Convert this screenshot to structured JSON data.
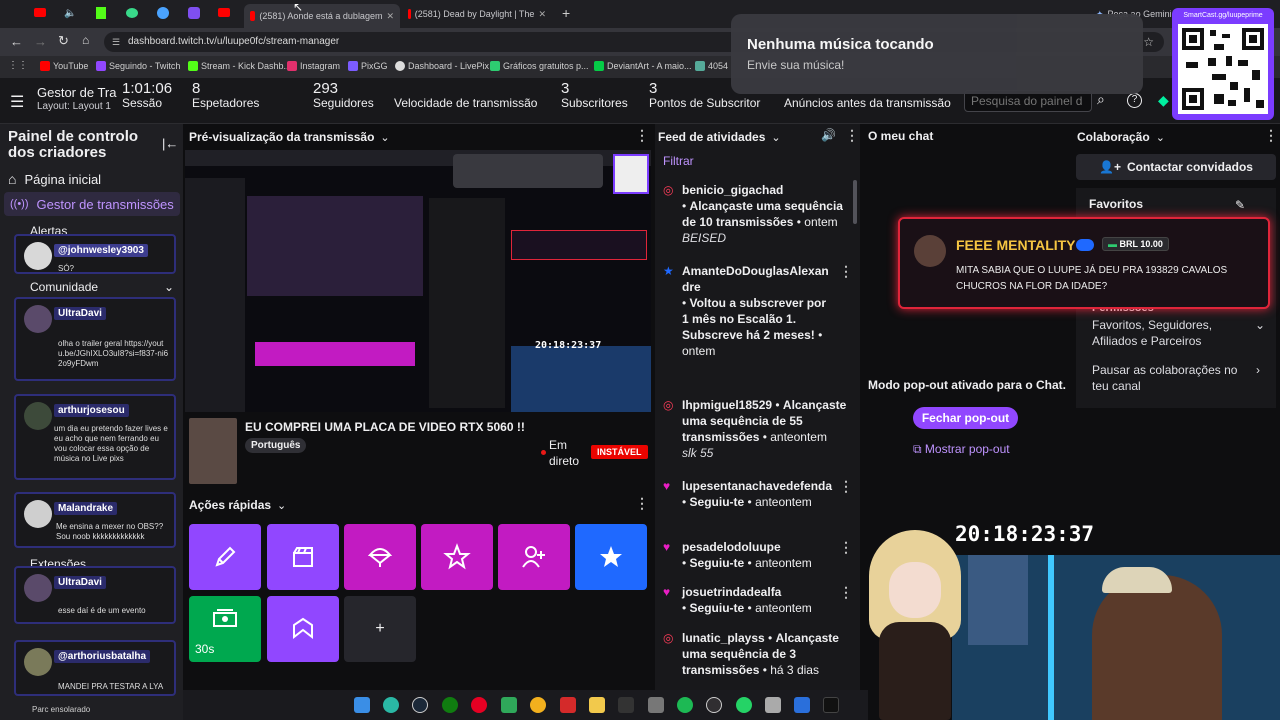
{
  "browser": {
    "tabs": [
      {
        "label": ""
      },
      {
        "label": ""
      },
      {
        "label": ""
      },
      {
        "label": ""
      },
      {
        "label": ""
      },
      {
        "label": ""
      },
      {
        "label": ""
      },
      {
        "label": "(2581) Aonde está a dublagem"
      },
      {
        "label": "(2581) Dead by Daylight | The"
      },
      {
        "label": "Peça ao Gemini"
      }
    ],
    "url": "dashboard.twitch.tv/u/luupe0fc/stream-manager",
    "bookmarks": [
      "YouTube",
      "Seguindo - Twitch",
      "Stream - Kick Dashb...",
      "Instagram",
      "PixGG",
      "Dashboard - LivePix",
      "Gráficos gratuitos p...",
      "DeviantArt - A maio...",
      "4054"
    ]
  },
  "notification": {
    "title": "Nenhuma música tocando",
    "subtitle": "Envie sua música!",
    "qr_label": "SmartCast.gg/luupeprime"
  },
  "topnav": {
    "channel": "Gestor de Trar",
    "layout": "Layout: Layout 1",
    "session_value": "1:01:06",
    "session_label": "Sessão",
    "viewers_value": "8",
    "viewers_label": "Espetadores",
    "followers_value": "293",
    "followers_label": "Seguidores",
    "bitrate_label": "Velocidade de transmissão",
    "subs_value": "3",
    "subs_label": "Subscritores",
    "subpoints_value": "3",
    "subpoints_label": "Pontos de Subscritor",
    "ads_label": "Anúncios antes da transmissão",
    "search_placeholder": "Pesquisa do painel d"
  },
  "leftnav": {
    "title": "Painel de controlo dos criadores",
    "items": [
      {
        "label": "Página inicial"
      },
      {
        "label": "Gestor de transmissões"
      },
      {
        "label": "Alertas"
      },
      {
        "label": "Comunidade"
      },
      {
        "label": "Extensões"
      }
    ]
  },
  "chat_overlay": [
    {
      "name": "@johnwesley3903",
      "text": "SÓ?"
    },
    {
      "name": "UltraDavi",
      "text": "olha o trailer geral https://youtu.be/JGhIXLO3uI8?si=f837-ni62o9yFDwm"
    },
    {
      "name": "arthurjosesou",
      "text": "um dia eu pretendo fazer lives e eu acho que nem ferrando eu vou colocar essa opção de música no Live pixs"
    },
    {
      "name": "Malandrake",
      "text": "Me ensina a mexer no OBS?? Sou noob kkkkkkkkkkkkk"
    },
    {
      "name": "UltraDavi",
      "text": "esse daí é de um evento"
    },
    {
      "name": "@arthoriusbatalha",
      "text": "MANDEI PRA TESTAR A LYA"
    }
  ],
  "preview": {
    "header": "Pré-visualização da transmissão",
    "stream_title": "EU COMPREI UMA PLACA DE VIDEO RTX 5060 !!",
    "language": "Português",
    "live_label": "Em direto",
    "status": "INSTÁVEL",
    "clock": "20:18:23:37"
  },
  "quick_actions": {
    "header": "Ações rápidas",
    "timer_label": "30s",
    "add_label": "+"
  },
  "feed": {
    "header": "Feed de atividades",
    "filter": "Filtrar",
    "items": [
      {
        "user": "benicio_gigachad",
        "text": "Alcançaste uma sequência de 10 transmissões",
        "time": "ontem",
        "extra": "BEISED"
      },
      {
        "user": "AmanteDoDouglasAlexandre",
        "text": "Voltou a subscrever por 1 mês no Escalão 1. Subscreve há 2 meses!",
        "time": "ontem",
        "extra": ""
      },
      {
        "user": "Ihpmiguel18529",
        "text": "Alcançaste uma sequência de 55 transmissões",
        "time": "anteontem",
        "extra": "slk 55"
      },
      {
        "user": "lupesentanachavedefenda",
        "text": "Seguiu-te",
        "time": "anteontem",
        "extra": ""
      },
      {
        "user": "pesadelodoluupe",
        "text": "Seguiu-te",
        "time": "anteontem",
        "extra": ""
      },
      {
        "user": "josuetrindadealfa",
        "text": "Seguiu-te",
        "time": "anteontem",
        "extra": ""
      },
      {
        "user": "lunatic_playss",
        "text": "Alcançaste uma sequência de 3 transmissões",
        "time": "há 3 dias",
        "extra": ""
      }
    ]
  },
  "chat": {
    "header": "O meu chat",
    "popout_text": "Modo pop-out ativado para o Chat.",
    "close_popout": "Fechar pop-out",
    "show_popout": "Mostrar pop-out"
  },
  "collab": {
    "header": "Colaboração",
    "contact_button": "Contactar convidados",
    "favorites": "Favoritos",
    "permissions_label": "Permissões",
    "permissions_value": "Favoritos, Seguidores, Afiliados e Parceiros",
    "pause_label": "Pausar as colaborações no teu canal"
  },
  "donation": {
    "name": "FEEE MENTALITY",
    "amount": "BRL 10.00",
    "message": "MITA SABIA QUE O LUUPE JÁ DEU PRA 193829 CAVALOS CHUCROS NA FLOR DA IDADE?"
  },
  "webcam": {
    "clock": "20:18:23:37"
  },
  "taskbar": {
    "weather": "Parc ensolarado"
  },
  "colors": {
    "twitch_purple": "#9147ff",
    "magenta": "#c21bc2",
    "blue": "#1f69ff",
    "green": "#00a84f",
    "donation_red": "#e0253a"
  }
}
